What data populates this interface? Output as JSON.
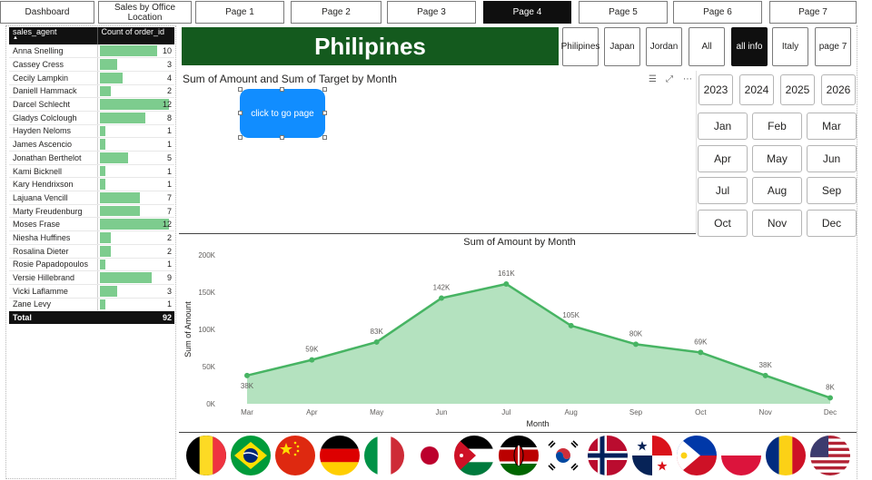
{
  "nav": [
    {
      "label": "Dashboard",
      "left": 0
    },
    {
      "label": "Sales by Office Location"
    },
    {
      "label": "Page 1"
    },
    {
      "label": "Page 2"
    },
    {
      "label": "Page 3"
    },
    {
      "label": "Page 4",
      "active": true
    },
    {
      "label": "Page 5"
    },
    {
      "label": "Page 6"
    },
    {
      "label": "Page 7"
    }
  ],
  "table": {
    "col_agent": "sales_agent",
    "col_count": "Count of order_id",
    "rows": [
      {
        "name": "Anna Snelling",
        "count": 10
      },
      {
        "name": "Cassey Cress",
        "count": 3
      },
      {
        "name": "Cecily Lampkin",
        "count": 4
      },
      {
        "name": "Daniell Hammack",
        "count": 2
      },
      {
        "name": "Darcel Schlecht",
        "count": 12
      },
      {
        "name": "Gladys Colclough",
        "count": 8
      },
      {
        "name": "Hayden Neloms",
        "count": 1
      },
      {
        "name": "James Ascencio",
        "count": 1
      },
      {
        "name": "Jonathan Berthelot",
        "count": 5
      },
      {
        "name": "Kami Bicknell",
        "count": 1
      },
      {
        "name": "Kary Hendrixson",
        "count": 1
      },
      {
        "name": "Lajuana Vencill",
        "count": 7
      },
      {
        "name": "Marty Freudenburg",
        "count": 7
      },
      {
        "name": "Moses Frase",
        "count": 12
      },
      {
        "name": "Niesha Huffines",
        "count": 2
      },
      {
        "name": "Rosalina Dieter",
        "count": 2
      },
      {
        "name": "Rosie Papadopoulos",
        "count": 1
      },
      {
        "name": "Versie Hillebrand",
        "count": 9
      },
      {
        "name": "Vicki Laflamme",
        "count": 3
      },
      {
        "name": "Zane Levy",
        "count": 1
      }
    ],
    "total_label": "Total",
    "total_value": "92",
    "bar_color": "#7dcc8e"
  },
  "banner": {
    "title": "Philipines",
    "color": "#145a1e"
  },
  "countries": [
    {
      "label": "Philipines"
    },
    {
      "label": "Japan"
    },
    {
      "label": "Jordan"
    },
    {
      "label": "All"
    },
    {
      "label": "all info",
      "active": true
    },
    {
      "label": "Italy"
    },
    {
      "label": "page 7"
    }
  ],
  "years": [
    "2023",
    "2024",
    "2025",
    "2026"
  ],
  "months": [
    "Jan",
    "Feb",
    "Mar",
    "Apr",
    "May",
    "Jun",
    "Jul",
    "Aug",
    "Sep",
    "Oct",
    "Nov",
    "Dec"
  ],
  "chart1": {
    "title": "Sum of Amount and Sum of Target by Month"
  },
  "go_button": {
    "label": "click to go page"
  },
  "header_icons": [
    "filter-icon",
    "expand-icon",
    "more-options-icon"
  ],
  "chart_data": {
    "type": "area",
    "title": "Sum of Amount by Month",
    "xlabel": "Month",
    "ylabel": "Sum of Amount",
    "categories": [
      "Mar",
      "Apr",
      "May",
      "Jun",
      "Jul",
      "Aug",
      "Sep",
      "Oct",
      "Nov",
      "Dec"
    ],
    "values": [
      38000,
      59000,
      83000,
      142000,
      161000,
      105000,
      80000,
      69000,
      38000,
      8000
    ],
    "data_labels": [
      "38K",
      "59K",
      "83K",
      "142K",
      "161K",
      "105K",
      "80K",
      "69K",
      "38K",
      "8K"
    ],
    "y_ticks": [
      0,
      50000,
      100000,
      150000,
      200000
    ],
    "y_tick_labels": [
      "0K",
      "50K",
      "100K",
      "150K",
      "200K"
    ],
    "ylim": [
      0,
      200000
    ],
    "grid": false,
    "line_color": "#47b463",
    "fill_color": "#b4e2bf"
  },
  "flags": [
    "belgium-flag",
    "brazil-flag",
    "china-flag",
    "germany-flag",
    "italy-flag",
    "japan-flag",
    "jordan-flag",
    "kenya-flag",
    "south-korea-flag",
    "norway-flag",
    "panama-flag",
    "philippines-flag",
    "poland-flag",
    "romania-flag",
    "usa-flag"
  ]
}
